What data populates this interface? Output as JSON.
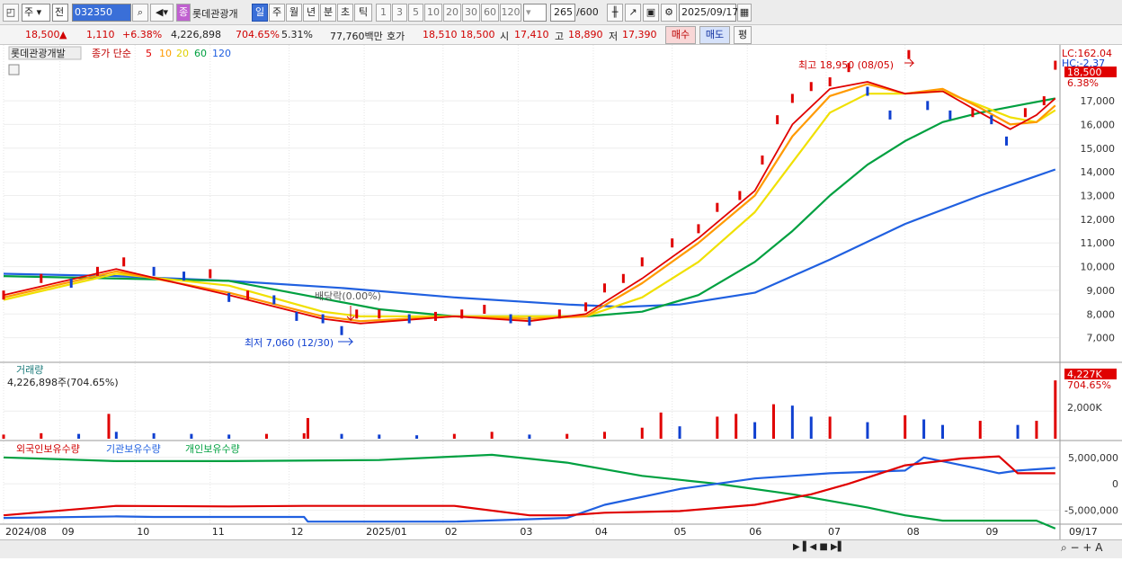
{
  "toolbar": {
    "market": "주",
    "type": "전",
    "code": "032350",
    "stock_name_badge": "종",
    "stock_name": "롯데관광개",
    "period_tabs": [
      "일",
      "주",
      "월",
      "년",
      "분",
      "초",
      "틱"
    ],
    "active_period": "일",
    "intervals": [
      "1",
      "3",
      "5",
      "10",
      "20",
      "30",
      "60",
      "120"
    ],
    "count": "265",
    "count_max": "/600",
    "date": "2025/09/17"
  },
  "quote": {
    "price": "18,500",
    "arrow": "▲",
    "change": "1,110",
    "change_pct": "+6.38%",
    "volume": "4,226,898",
    "volume_pct": "704.65%",
    "turnover_pct": "5.31%",
    "amount": "77,760백만",
    "bid_label": "호가",
    "ask": "18,510",
    "bid": "18,500",
    "open_label": "시",
    "open": "17,410",
    "high_label": "고",
    "high": "18,890",
    "low_label": "저",
    "low": "17,390",
    "buy_btn": "매수",
    "sell_btn": "매도",
    "table_btn": "평"
  },
  "chart_data": {
    "type": "line",
    "title": "롯데관광개발",
    "legend": {
      "label": "종가 단순",
      "ma": [
        {
          "name": "5",
          "color": "#e00000"
        },
        {
          "name": "10",
          "color": "#ff9a00"
        },
        {
          "name": "20",
          "color": "#f0e000"
        },
        {
          "name": "60",
          "color": "#00a040"
        },
        {
          "name": "120",
          "color": "#2060e0"
        }
      ]
    },
    "price_axis": {
      "ylim": [
        6000,
        18900
      ],
      "ticks": [
        "17,000",
        "16,000",
        "15,000",
        "14,000",
        "13,000",
        "12,000",
        "11,000",
        "10,000",
        "9,000",
        "8,000",
        "7,000"
      ]
    },
    "x_tick_labels": [
      "2024/08",
      "09",
      "10",
      "11",
      "12",
      "2025/01",
      "02",
      "03",
      "04",
      "05",
      "06",
      "07",
      "08",
      "09",
      "09/17"
    ],
    "x_tick_index": [
      0,
      15,
      35,
      55,
      76,
      96,
      117,
      137,
      157,
      178,
      198,
      219,
      240,
      261,
      281
    ],
    "x_count": 281,
    "close_series": {
      "x": [
        0,
        10,
        18,
        25,
        32,
        40,
        48,
        55,
        60,
        65,
        72,
        78,
        85,
        90,
        94,
        100,
        108,
        115,
        122,
        128,
        135,
        140,
        148,
        155,
        160,
        165,
        170,
        178,
        185,
        190,
        196,
        202,
        206,
        210,
        215,
        220,
        225,
        230,
        236,
        241,
        246,
        252,
        258,
        263,
        267,
        272,
        277,
        280
      ],
      "y": [
        8800,
        9500,
        9300,
        9800,
        10200,
        9800,
        9600,
        9700,
        8700,
        8800,
        8600,
        7900,
        7800,
        7300,
        8000,
        8000,
        7800,
        7900,
        8000,
        8200,
        7800,
        7700,
        8000,
        8300,
        9100,
        9500,
        10200,
        11000,
        11600,
        12500,
        13000,
        14500,
        16200,
        17100,
        17600,
        17800,
        18400,
        17400,
        16400,
        18950,
        16800,
        16400,
        16500,
        16200,
        15300,
        16500,
        17000,
        18500
      ]
    },
    "ma": {
      "5": {
        "x": [
          0,
          30,
          60,
          85,
          95,
          120,
          140,
          155,
          170,
          185,
          200,
          210,
          220,
          230,
          240,
          250,
          260,
          268,
          275,
          280
        ],
        "y": [
          8800,
          9900,
          8800,
          7800,
          7600,
          7900,
          7700,
          8000,
          9500,
          11200,
          13200,
          16000,
          17500,
          17800,
          17300,
          17400,
          16500,
          15800,
          16400,
          17100
        ]
      },
      "10": {
        "x": [
          0,
          30,
          60,
          85,
          95,
          120,
          140,
          155,
          170,
          185,
          200,
          210,
          220,
          230,
          240,
          250,
          260,
          268,
          275,
          280
        ],
        "y": [
          8700,
          9800,
          8900,
          7900,
          7700,
          7900,
          7800,
          7900,
          9300,
          11000,
          13000,
          15500,
          17200,
          17700,
          17300,
          17500,
          16700,
          16000,
          16100,
          16800
        ]
      },
      "20": {
        "x": [
          0,
          30,
          60,
          85,
          95,
          120,
          140,
          155,
          170,
          185,
          200,
          210,
          220,
          230,
          240,
          250,
          260,
          268,
          275,
          280
        ],
        "y": [
          8600,
          9700,
          9200,
          8100,
          7900,
          7900,
          7900,
          7900,
          8700,
          10200,
          12300,
          14400,
          16500,
          17300,
          17300,
          17400,
          16800,
          16300,
          16100,
          16600
        ]
      },
      "60": {
        "x": [
          0,
          30,
          60,
          80,
          100,
          120,
          140,
          155,
          170,
          185,
          200,
          210,
          220,
          230,
          240,
          250,
          260,
          270,
          280
        ],
        "y": [
          9600,
          9500,
          9400,
          8800,
          8200,
          7900,
          7900,
          7900,
          8100,
          8800,
          10200,
          11500,
          13000,
          14300,
          15300,
          16100,
          16500,
          16800,
          17100
        ]
      },
      "120": {
        "x": [
          0,
          30,
          60,
          90,
          120,
          150,
          165,
          180,
          200,
          220,
          240,
          260,
          280
        ],
        "y": [
          9700,
          9600,
          9400,
          9100,
          8700,
          8400,
          8300,
          8400,
          8900,
          10300,
          11800,
          13000,
          14100
        ]
      }
    },
    "annotations": {
      "high": "최고 18,950 (08/05)",
      "low": "최저 7,060 (12/30)",
      "dividend": "배당락(0.00%)",
      "lc": "LC:162.04",
      "hc": "HC:-2.37",
      "last_price": "18,500",
      "last_pct": "6.38%"
    },
    "volume_panel": {
      "label": "거래량",
      "value_text": "4,226,898주(704.65%)",
      "tick": "2,000K",
      "last": "4,227K",
      "last_pct": "704.65%",
      "ylim": [
        0,
        4300
      ],
      "x": [
        0,
        10,
        20,
        28,
        30,
        40,
        50,
        60,
        70,
        80,
        81,
        90,
        100,
        110,
        120,
        130,
        140,
        150,
        160,
        170,
        175,
        180,
        190,
        195,
        200,
        205,
        210,
        215,
        220,
        230,
        240,
        245,
        250,
        260,
        270,
        275,
        280
      ],
      "values": [
        300,
        400,
        350,
        1800,
        500,
        400,
        350,
        300,
        350,
        400,
        1500,
        350,
        300,
        250,
        350,
        500,
        300,
        350,
        500,
        800,
        1900,
        900,
        1600,
        1800,
        1200,
        2500,
        2400,
        1600,
        1600,
        1200,
        1700,
        1400,
        1000,
        1300,
        1000,
        1300,
        4227
      ]
    },
    "holdings_panel": {
      "series_names": [
        "외국인보유수량",
        "기관보유수량",
        "개인보유수량"
      ],
      "colors": [
        "#e00000",
        "#2060e0",
        "#00a040"
      ],
      "ticks": [
        "5,000,000",
        "0",
        "-5,000,000"
      ],
      "ylim": [
        -7500000,
        6500000
      ],
      "foreign": {
        "x": [
          0,
          30,
          60,
          80,
          120,
          140,
          150,
          160,
          180,
          200,
          215,
          225,
          240,
          255,
          265,
          270,
          280
        ],
        "y": [
          -6000000,
          -4200000,
          -4300000,
          -4200000,
          -4200000,
          -6000000,
          -6000000,
          -5500000,
          -5200000,
          -4000000,
          -2000000,
          0,
          3500000,
          4800000,
          5200000,
          2000000,
          2000000
        ]
      },
      "institution": {
        "x": [
          0,
          30,
          40,
          80,
          81,
          120,
          150,
          160,
          180,
          200,
          220,
          240,
          245,
          260,
          265,
          270,
          280
        ],
        "y": [
          -6500000,
          -6200000,
          -6300000,
          -6300000,
          -7200000,
          -7200000,
          -6500000,
          -4000000,
          -1000000,
          1000000,
          2000000,
          2500000,
          5000000,
          2800000,
          2000000,
          2500000,
          3000000
        ]
      },
      "individual": {
        "x": [
          0,
          30,
          60,
          100,
          130,
          150,
          170,
          190,
          210,
          230,
          240,
          250,
          265,
          275,
          280
        ],
        "y": [
          5000000,
          4300000,
          4300000,
          4500000,
          5500000,
          4000000,
          1500000,
          0,
          -2000000,
          -4500000,
          -6000000,
          -7000000,
          -7000000,
          -7000000,
          -8500000
        ]
      }
    }
  }
}
